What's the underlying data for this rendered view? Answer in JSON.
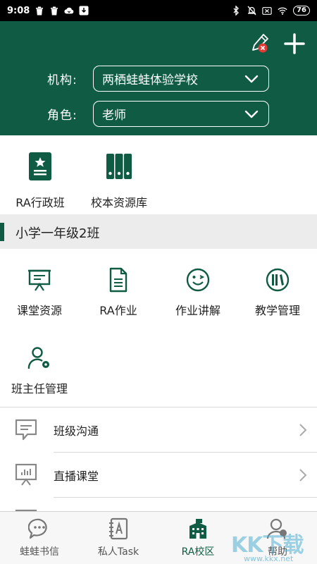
{
  "status_bar": {
    "time": "9:08",
    "battery": "76",
    "left_icons": [
      "trash-icon",
      "trash-icon",
      "cloud-icon",
      "download-icon"
    ],
    "right_icons": [
      "bluetooth-icon",
      "bell-off-icon",
      "no-sim-icon",
      "wifi-icon"
    ]
  },
  "header": {
    "org_label": "机构:",
    "org_value": "两栖蛙蛙体验学校",
    "role_label": "角色:",
    "role_value": "老师",
    "bg_color": "#0f5b44"
  },
  "quick_tiles": [
    {
      "label": "RA行政班",
      "icon": "badge-star-icon"
    },
    {
      "label": "校本资源库",
      "icon": "binders-icon"
    }
  ],
  "class_bar": {
    "title": "小学一年级2班"
  },
  "features": [
    {
      "label": "课堂资源",
      "icon": "presentation-board-icon"
    },
    {
      "label": "RA作业",
      "icon": "document-icon"
    },
    {
      "label": "作业讲解",
      "icon": "wink-face-icon"
    },
    {
      "label": "教学管理",
      "icon": "books-circle-icon"
    },
    {
      "label": "班主任管理",
      "icon": "user-settings-icon"
    }
  ],
  "list": [
    {
      "label": "班级沟通",
      "icon": "chat-bubble-icon"
    },
    {
      "label": "直播课堂",
      "icon": "live-board-icon"
    }
  ],
  "bottom_nav": [
    {
      "label": "蛙蛙书信",
      "icon": "chat-dots-icon",
      "active": false
    },
    {
      "label": "私人Task",
      "icon": "notebook-a-icon",
      "active": false
    },
    {
      "label": "RA校区",
      "icon": "school-building-icon",
      "active": true
    },
    {
      "label": "帮助",
      "icon": "help-user-icon",
      "active": false
    }
  ],
  "watermark": {
    "text": "KK下载",
    "url": "www.kkx.net"
  },
  "colors": {
    "accent": "#0f5b44",
    "badge_red": "#e53935"
  }
}
